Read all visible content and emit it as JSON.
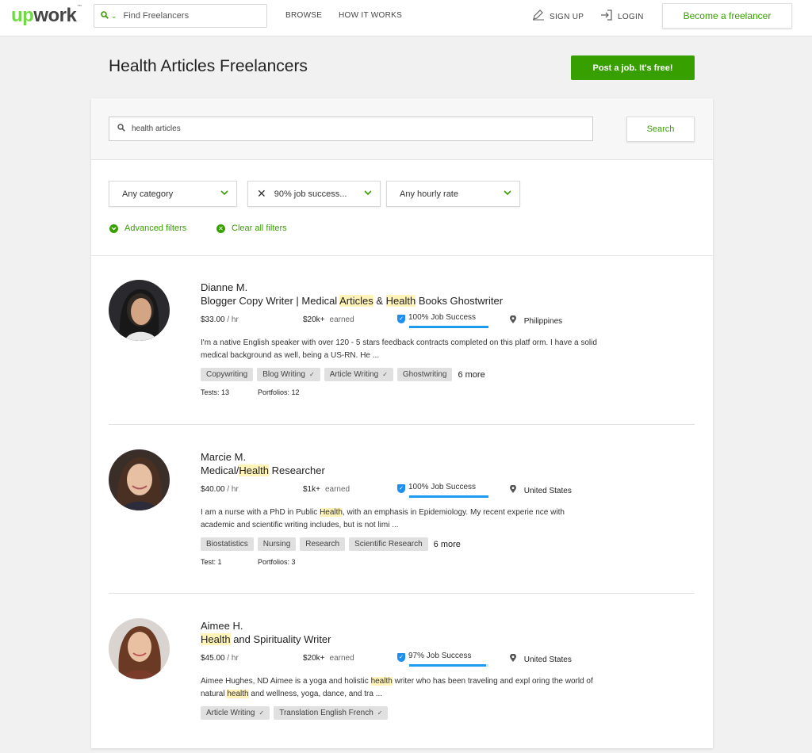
{
  "header": {
    "logo_main": "up",
    "logo_rest": "work",
    "logo_tm": "™",
    "search_placeholder": "Find Freelancers",
    "nav_browse": "BROWSE",
    "nav_how": "HOW IT WORKS",
    "signup": "SIGN UP",
    "login": "LOGIN",
    "become": "Become a freelancer"
  },
  "page": {
    "title": "Health Articles Freelancers",
    "post_job": "Post a job. It's free!"
  },
  "search": {
    "value": "health articles",
    "button": "Search"
  },
  "filters": {
    "category": "Any category",
    "job_success": "90% job success...",
    "hourly_rate": "Any hourly rate",
    "advanced": "Advanced filters",
    "clear": "Clear all filters"
  },
  "freelancers": [
    {
      "name": "Dianne M.",
      "title_parts": [
        "Blogger Copy Writer | Medical ",
        "Articles",
        " & ",
        "Health",
        " Books Ghostwriter"
      ],
      "rate": "$33.00",
      "rate_unit": "/ hr",
      "earned": "$20k+",
      "earned_label": "earned",
      "job_success": "100% Job Success",
      "job_success_pct": 100,
      "location": "Philippines",
      "desc_parts": [
        "I'm a native English speaker with over 120 - 5 stars feedback contracts completed on this platf orm. I have a solid medical background as well, being a US-RN. He ..."
      ],
      "skills": [
        {
          "label": "Copywriting",
          "check": ""
        },
        {
          "label": "Blog Writing",
          "check": "✓"
        },
        {
          "label": "Article Writing",
          "check": "✓"
        },
        {
          "label": "Ghostwriting",
          "check": ""
        }
      ],
      "more": "6 more",
      "tests": "Tests: 13",
      "portfolios": "Portfolios: 12"
    },
    {
      "name": "Marcie M.",
      "title_parts": [
        "Medical/",
        "Health",
        " Researcher"
      ],
      "rate": "$40.00",
      "rate_unit": "/ hr",
      "earned": "$1k+",
      "earned_label": "earned",
      "job_success": "100% Job Success",
      "job_success_pct": 100,
      "location": "United States",
      "desc_parts": [
        "I am a nurse with a PhD in Public ",
        "Health",
        ", with an emphasis in Epidemiology. My recent experie nce with academic and scientific writing includes, but is not limi ..."
      ],
      "skills": [
        {
          "label": "Biostatistics",
          "check": ""
        },
        {
          "label": "Nursing",
          "check": ""
        },
        {
          "label": "Research",
          "check": ""
        },
        {
          "label": "Scientific Research",
          "check": ""
        }
      ],
      "more": "6 more",
      "tests": "Test: 1",
      "portfolios": "Portfolios: 3"
    },
    {
      "name": "Aimee H.",
      "title_parts": [
        "Health",
        " and Spirituality Writer"
      ],
      "rate": "$45.00",
      "rate_unit": "/ hr",
      "earned": "$20k+",
      "earned_label": "earned",
      "job_success": "97% Job Success",
      "job_success_pct": 97,
      "location": "United States",
      "desc_parts": [
        "Aimee Hughes, ND Aimee is a yoga and holistic ",
        "health",
        " writer who has been traveling and expl oring the world of natural ",
        "health",
        " and wellness, yoga, dance, and tra ..."
      ],
      "skills": [
        {
          "label": "Article Writing",
          "check": "✓"
        },
        {
          "label": "Translation English French",
          "check": "✓"
        }
      ],
      "more": "",
      "tests": "",
      "portfolios": ""
    }
  ],
  "colors": {
    "brand_green": "#37a000",
    "logo_green": "#6fda44",
    "job_success_blue": "#1d9bf0",
    "highlight": "#fff3b8"
  }
}
